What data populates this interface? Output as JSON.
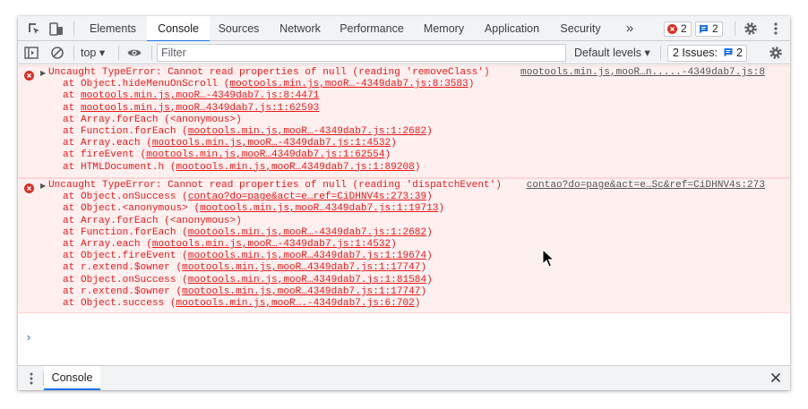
{
  "tabs": [
    "Elements",
    "Console",
    "Sources",
    "Network",
    "Performance",
    "Memory",
    "Application",
    "Security"
  ],
  "more_tabs": "»",
  "error_count": "2",
  "message_count": "2",
  "toolbar": {
    "context": "top ▾",
    "filter_placeholder": "Filter",
    "levels": "Default levels ▾",
    "issues_label": "2 Issues:",
    "issues_count": "2"
  },
  "errors": [
    {
      "message": "Uncaught TypeError: Cannot read properties of null (reading 'removeClass')",
      "source": "mootools.min.js,mooR…n.....-4349dab7.js:8",
      "stack": [
        {
          "prefix": "at Object.hideMenuOnScroll (",
          "link": "mootools.min.js,mooR…-4349dab7.js:8:3583",
          "suffix": ")"
        },
        {
          "prefix": "at ",
          "link": "mootools.min.js,mooR…-4349dab7.js:8:4471",
          "suffix": ""
        },
        {
          "prefix": "at ",
          "link": "mootools.min.js,mooR…4349dab7.js:1:62593",
          "suffix": ""
        },
        {
          "prefix": "at Array.forEach (<anonymous>)",
          "link": "",
          "suffix": ""
        },
        {
          "prefix": "at Function.forEach (",
          "link": "mootools.min.js,mooR…-4349dab7.js:1:2682",
          "suffix": ")"
        },
        {
          "prefix": "at Array.each (",
          "link": "mootools.min.js,mooR…-4349dab7.js:1:4532",
          "suffix": ")"
        },
        {
          "prefix": "at fireEvent (",
          "link": "mootools.min.js,mooR…4349dab7.js:1:62554",
          "suffix": ")"
        },
        {
          "prefix": "at HTMLDocument.h (",
          "link": "mootools.min.js,mooR…4349dab7.js:1:89208",
          "suffix": ")"
        }
      ]
    },
    {
      "message": "Uncaught TypeError: Cannot read properties of null (reading 'dispatchEvent')",
      "source": "contao?do=page&act=e…Sc&ref=CiDHNV4s:273",
      "stack": [
        {
          "prefix": "at Object.onSuccess (",
          "link": "contao?do=page&act=e…ref=CiDHNV4s:273:39",
          "suffix": ")"
        },
        {
          "prefix": "at Object.<anonymous> (",
          "link": "mootools.min.js,mooR…4349dab7.js:1:19713",
          "suffix": ")"
        },
        {
          "prefix": "at Array.forEach (<anonymous>)",
          "link": "",
          "suffix": ""
        },
        {
          "prefix": "at Function.forEach (",
          "link": "mootools.min.js,mooR…-4349dab7.js:1:2682",
          "suffix": ")"
        },
        {
          "prefix": "at Array.each (",
          "link": "mootools.min.js,mooR…-4349dab7.js:1:4532",
          "suffix": ")"
        },
        {
          "prefix": "at Object.fireEvent (",
          "link": "mootools.min.js,mooR…4349dab7.js:1:19674",
          "suffix": ")"
        },
        {
          "prefix": "at r.extend.$owner (",
          "link": "mootools.min.js,mooR…4349dab7.js:1:17747",
          "suffix": ")"
        },
        {
          "prefix": "at Object.onSuccess (",
          "link": "mootools.min.js,mooR…4349dab7.js:1:81584",
          "suffix": ")"
        },
        {
          "prefix": "at r.extend.$owner (",
          "link": "mootools.min.js,mooR…4349dab7.js:1:17747",
          "suffix": ")"
        },
        {
          "prefix": "at Object.success (",
          "link": "mootools.min.js,mooR….-4349dab7.js:6:702",
          "suffix": ")"
        }
      ]
    }
  ],
  "prompt_symbol": "›",
  "drawer": {
    "tab": "Console"
  },
  "colors": {
    "error_text": "#e81919",
    "error_bg": "#fff0f0",
    "accent": "#1a73e8"
  }
}
